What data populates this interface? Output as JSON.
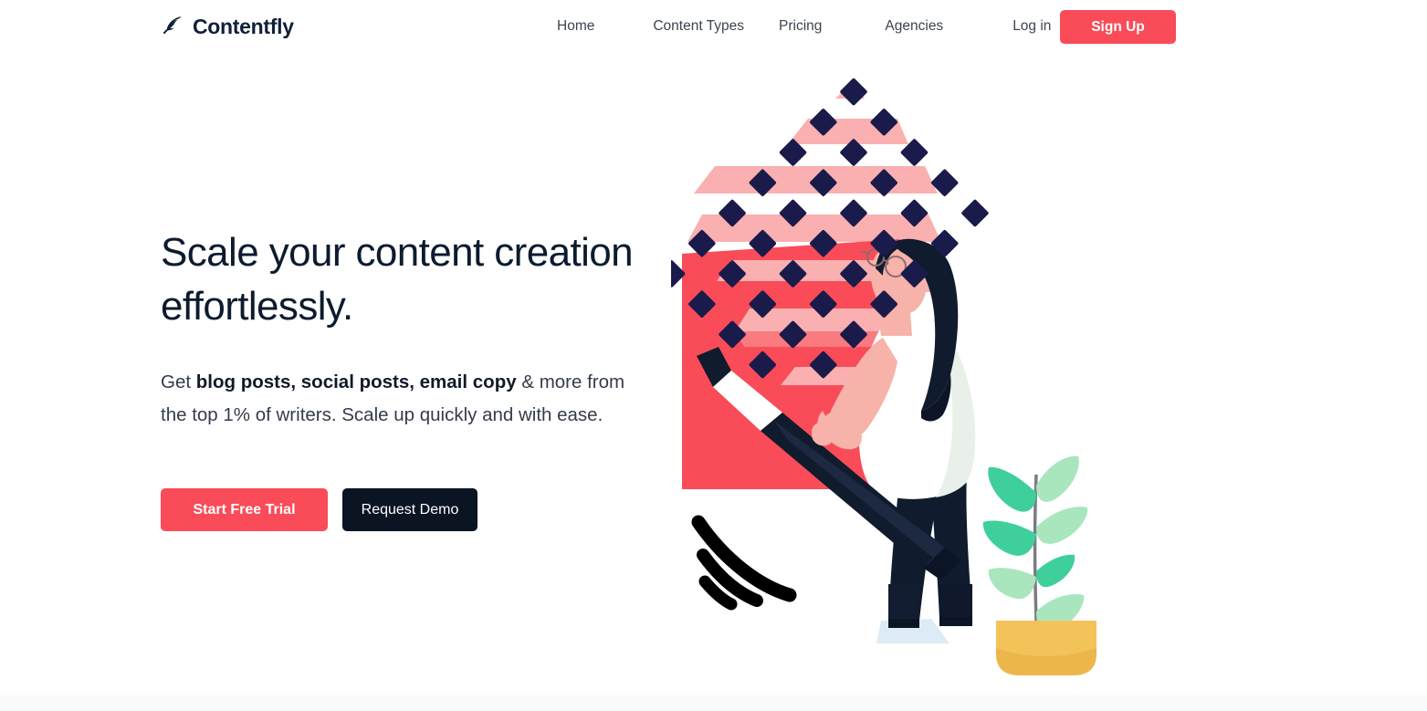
{
  "brand": {
    "name": "Contentfly",
    "icon": "feather-icon"
  },
  "nav": {
    "items": [
      {
        "label": "Home"
      },
      {
        "label": "Content Types"
      },
      {
        "label": "Pricing"
      },
      {
        "label": "Agencies"
      },
      {
        "label": "Log in"
      }
    ],
    "signup_label": "Sign Up"
  },
  "hero": {
    "title": "Scale your content creation effortlessly.",
    "subtitle_parts": {
      "lead": "Get ",
      "bold": "blog posts, social posts, email copy",
      "tail": " & more from the top 1% of writers. Scale up quickly and with ease."
    },
    "primary_cta": "Start Free Trial",
    "secondary_cta": "Request Demo",
    "illustration": "writer-with-giant-pencil-illustration"
  },
  "colors": {
    "brand_red": "#F94C58",
    "light_pink": "#FAB0B0",
    "navy": "#1A1B4B",
    "dark_text": "#0D1B2E",
    "nav_text": "#3D4451",
    "dark_button": "#0B1423",
    "skin": "#F7A9A0",
    "plant_green": "#3FCF9A",
    "plant_light_green": "#A9E6BE",
    "pot_yellow": "#F3C359",
    "section_bg": "#F9FAFC"
  }
}
